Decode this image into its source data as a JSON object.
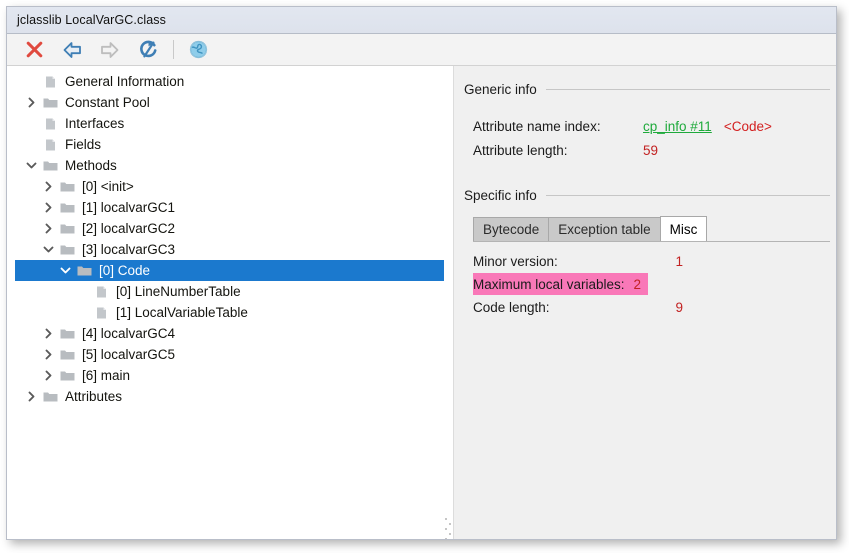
{
  "window": {
    "title": "jclasslib LocalVarGC.class"
  },
  "toolbar": {
    "buttons": [
      {
        "name": "close-icon",
        "label": "Close",
        "enabled": true
      },
      {
        "name": "back-icon",
        "label": "Back",
        "enabled": true
      },
      {
        "name": "forward-icon",
        "label": "Forward",
        "enabled": false
      },
      {
        "name": "reload-icon",
        "label": "Reload",
        "enabled": true
      },
      {
        "name": "browse-icon",
        "label": "Browse",
        "enabled": true
      }
    ]
  },
  "tree": {
    "nodes": [
      {
        "label": "General Information",
        "indent": 1,
        "icon": "document-icon",
        "twisty": "none",
        "selected": false
      },
      {
        "label": "Constant Pool",
        "indent": 1,
        "icon": "folder-icon",
        "twisty": "collapsed",
        "selected": false
      },
      {
        "label": "Interfaces",
        "indent": 1,
        "icon": "document-icon",
        "twisty": "none",
        "selected": false
      },
      {
        "label": "Fields",
        "indent": 1,
        "icon": "document-icon",
        "twisty": "none",
        "selected": false
      },
      {
        "label": "Methods",
        "indent": 1,
        "icon": "folder-icon",
        "twisty": "expanded",
        "selected": false
      },
      {
        "label": "[0] <init>",
        "indent": 2,
        "icon": "folder-icon",
        "twisty": "collapsed",
        "selected": false
      },
      {
        "label": "[1] localvarGC1",
        "indent": 2,
        "icon": "folder-icon",
        "twisty": "collapsed",
        "selected": false
      },
      {
        "label": "[2] localvarGC2",
        "indent": 2,
        "icon": "folder-icon",
        "twisty": "collapsed",
        "selected": false
      },
      {
        "label": "[3] localvarGC3",
        "indent": 2,
        "icon": "folder-icon",
        "twisty": "expanded",
        "selected": false
      },
      {
        "label": "[0] Code",
        "indent": 3,
        "icon": "folder-icon",
        "twisty": "expanded",
        "selected": true
      },
      {
        "label": "[0] LineNumberTable",
        "indent": 4,
        "icon": "document-icon",
        "twisty": "none",
        "selected": false
      },
      {
        "label": "[1] LocalVariableTable",
        "indent": 4,
        "icon": "document-icon",
        "twisty": "none",
        "selected": false
      },
      {
        "label": "[4] localvarGC4",
        "indent": 2,
        "icon": "folder-icon",
        "twisty": "collapsed",
        "selected": false
      },
      {
        "label": "[5] localvarGC5",
        "indent": 2,
        "icon": "folder-icon",
        "twisty": "collapsed",
        "selected": false
      },
      {
        "label": "[6] main",
        "indent": 2,
        "icon": "folder-icon",
        "twisty": "collapsed",
        "selected": false
      },
      {
        "label": "Attributes",
        "indent": 1,
        "icon": "folder-icon",
        "twisty": "collapsed",
        "selected": false
      }
    ]
  },
  "detail": {
    "generic": {
      "title": "Generic info",
      "rows": [
        {
          "key": "Attribute name index:",
          "link": "cp_info #11",
          "tag": "<Code>"
        },
        {
          "key": "Attribute length:",
          "value": "59"
        }
      ]
    },
    "specific": {
      "title": "Specific info",
      "tabs": [
        {
          "label": "Bytecode",
          "active": false
        },
        {
          "label": "Exception table",
          "active": false
        },
        {
          "label": "Misc",
          "active": true
        }
      ],
      "rows": [
        {
          "key": "Minor version:",
          "value": "1",
          "highlight": false
        },
        {
          "key": "Maximum local variables:",
          "value": "2",
          "highlight": true
        },
        {
          "key": "Code length:",
          "value": "9",
          "highlight": false
        }
      ]
    }
  },
  "colors": {
    "selection": "#1b79ce",
    "highlight": "#f978b8",
    "link": "#1faa3c",
    "value": "#c22222",
    "tag": "#d32020",
    "titlebar": "#dde2ec"
  }
}
